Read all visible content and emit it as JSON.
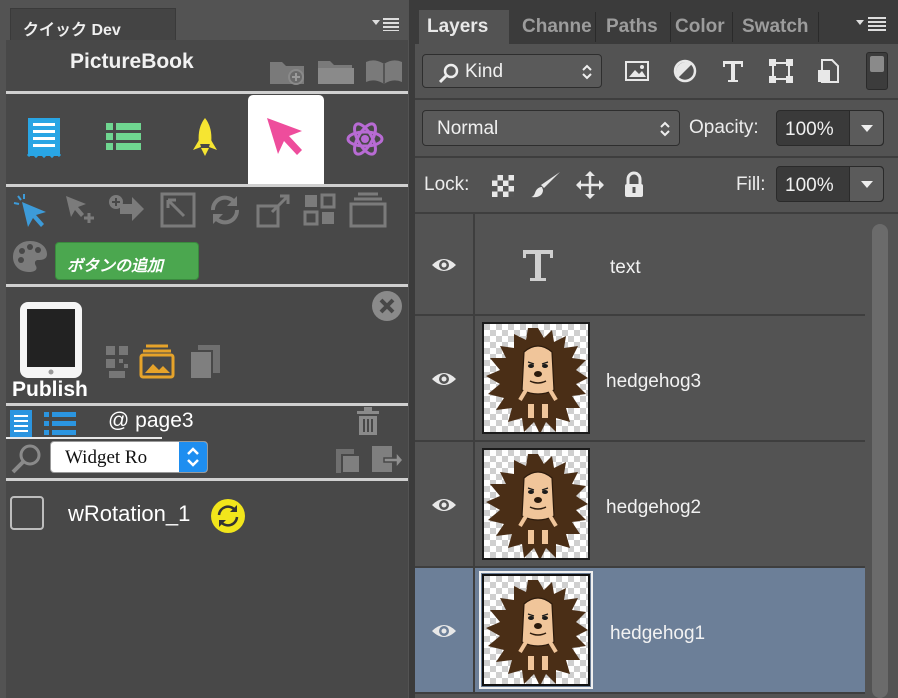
{
  "left_panel": {
    "tab_title": "クイック Dev",
    "header_title": "PictureBook",
    "header_icons": [
      "new-folder-icon",
      "folder-icon",
      "book-icon"
    ],
    "tools": [
      {
        "name": "page-tool-icon",
        "color": "#29a5e4"
      },
      {
        "name": "list-tool-icon",
        "color": "#6fd690"
      },
      {
        "name": "rocket-tool-icon",
        "color": "#f6e531"
      },
      {
        "name": "select-tool-icon",
        "color": "#ee4d9c",
        "selected": true
      },
      {
        "name": "atom-tool-icon",
        "color": "#b86bd4"
      }
    ],
    "widget_tools": [
      "select-cursor-icon",
      "move-tool-icon",
      "add-arrow-icon",
      "resize-icon",
      "rotate-icon",
      "scale-icon",
      "grid-icon",
      "stack-icon",
      "palette-icon"
    ],
    "tooltip": "ボタンの追加",
    "publish_label": "Publish",
    "page_label": "@ page3",
    "widget_select": "Widget Ro",
    "widget_row": {
      "name": "wRotation_1",
      "icon": "rotation-badge-icon",
      "icon_color": "#f1e51b"
    }
  },
  "layers_panel": {
    "tabs": [
      "Layers",
      "Channe",
      "Paths",
      "Color",
      "Swatch"
    ],
    "active_tab": "Layers",
    "filter_kind": "Kind",
    "filter_icons": [
      "image-filter-icon",
      "adjustment-filter-icon",
      "type-filter-icon",
      "shape-filter-icon",
      "smart-object-filter-icon"
    ],
    "blend_mode": "Normal",
    "opacity_label": "Opacity:",
    "opacity_value": "100%",
    "lock_label": "Lock:",
    "lock_icons": [
      "lock-transparent-icon",
      "lock-paint-icon",
      "lock-position-icon",
      "lock-all-icon"
    ],
    "fill_label": "Fill:",
    "fill_value": "100%",
    "layers": [
      {
        "name": "text",
        "type": "text",
        "visible": true,
        "selected": false
      },
      {
        "name": "hedgehog3",
        "type": "image",
        "visible": true,
        "selected": false
      },
      {
        "name": "hedgehog2",
        "type": "image",
        "visible": true,
        "selected": false
      },
      {
        "name": "hedgehog1",
        "type": "image",
        "visible": true,
        "selected": true
      }
    ],
    "selected_color": "#6c7f98"
  }
}
